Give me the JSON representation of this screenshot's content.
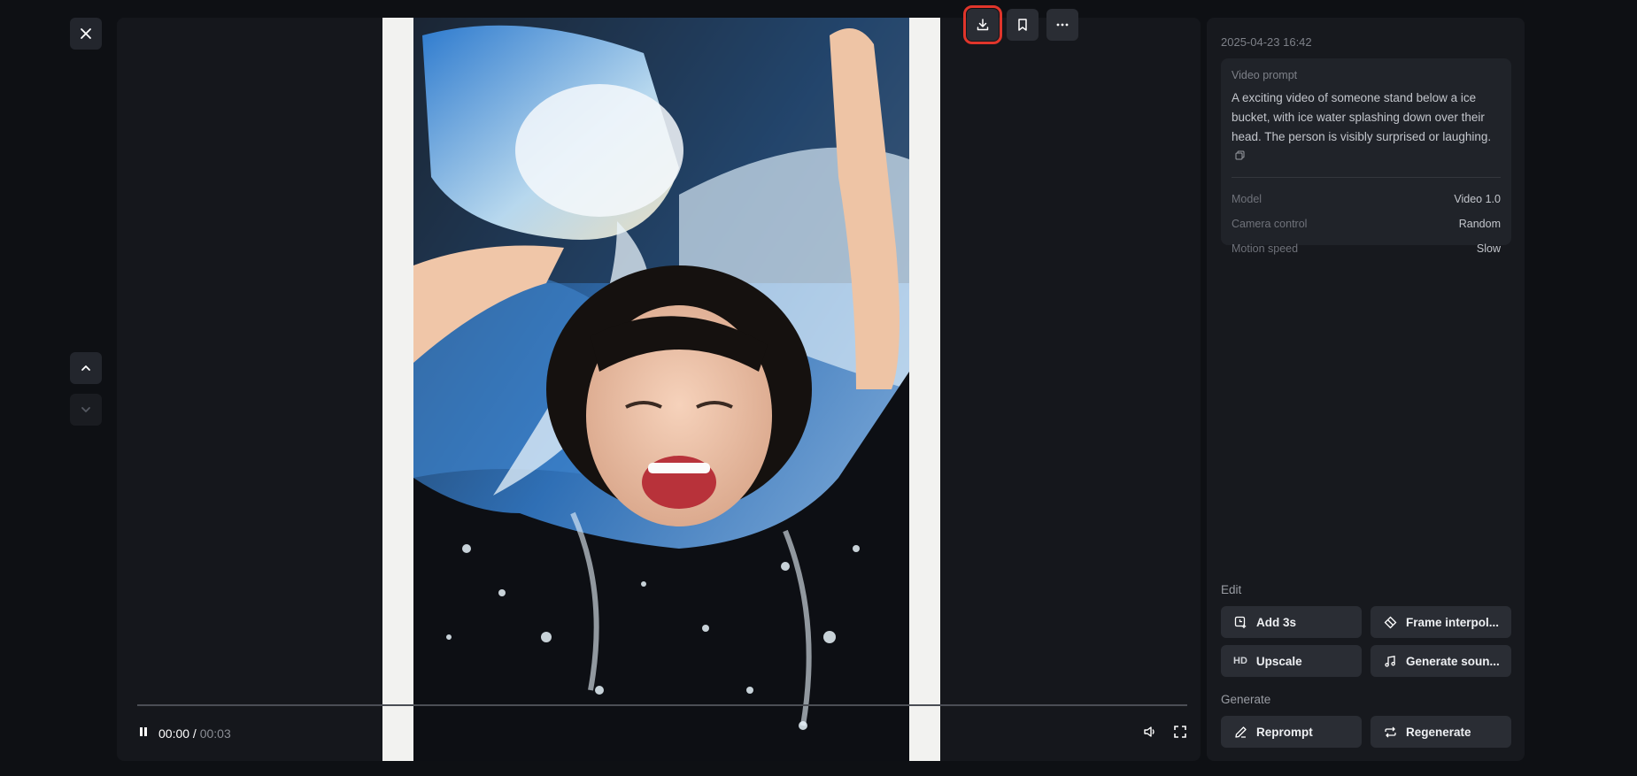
{
  "viewer": {
    "close_icon": "close-icon",
    "nav_up_icon": "chevron-up-icon",
    "nav_down_icon": "chevron-down-icon"
  },
  "actions": {
    "download_icon": "download-icon",
    "bookmark_icon": "bookmark-icon",
    "more_icon": "more-icon",
    "highlight_color": "#e0352b"
  },
  "player": {
    "current_time": "00:00",
    "separator": " / ",
    "duration": "00:03",
    "state": "playing",
    "progress": 0
  },
  "details": {
    "timestamp": "2025-04-23 16:42",
    "prompt_title": "Video prompt",
    "prompt_text": "A exciting video of someone stand below a ice bucket, with ice water splashing down over their head. The person is visibly surprised or laughing.",
    "meta": [
      {
        "key": "Model",
        "value": "Video 1.0"
      },
      {
        "key": "Camera control",
        "value": "Random"
      },
      {
        "key": "Motion speed",
        "value": "Slow"
      }
    ]
  },
  "edit": {
    "label": "Edit",
    "add": "Add 3s",
    "frame": "Frame interpol...",
    "upscale_badge": "HD",
    "upscale": "Upscale",
    "sound": "Generate soun..."
  },
  "generate": {
    "label": "Generate",
    "reprompt": "Reprompt",
    "regenerate": "Regenerate"
  }
}
